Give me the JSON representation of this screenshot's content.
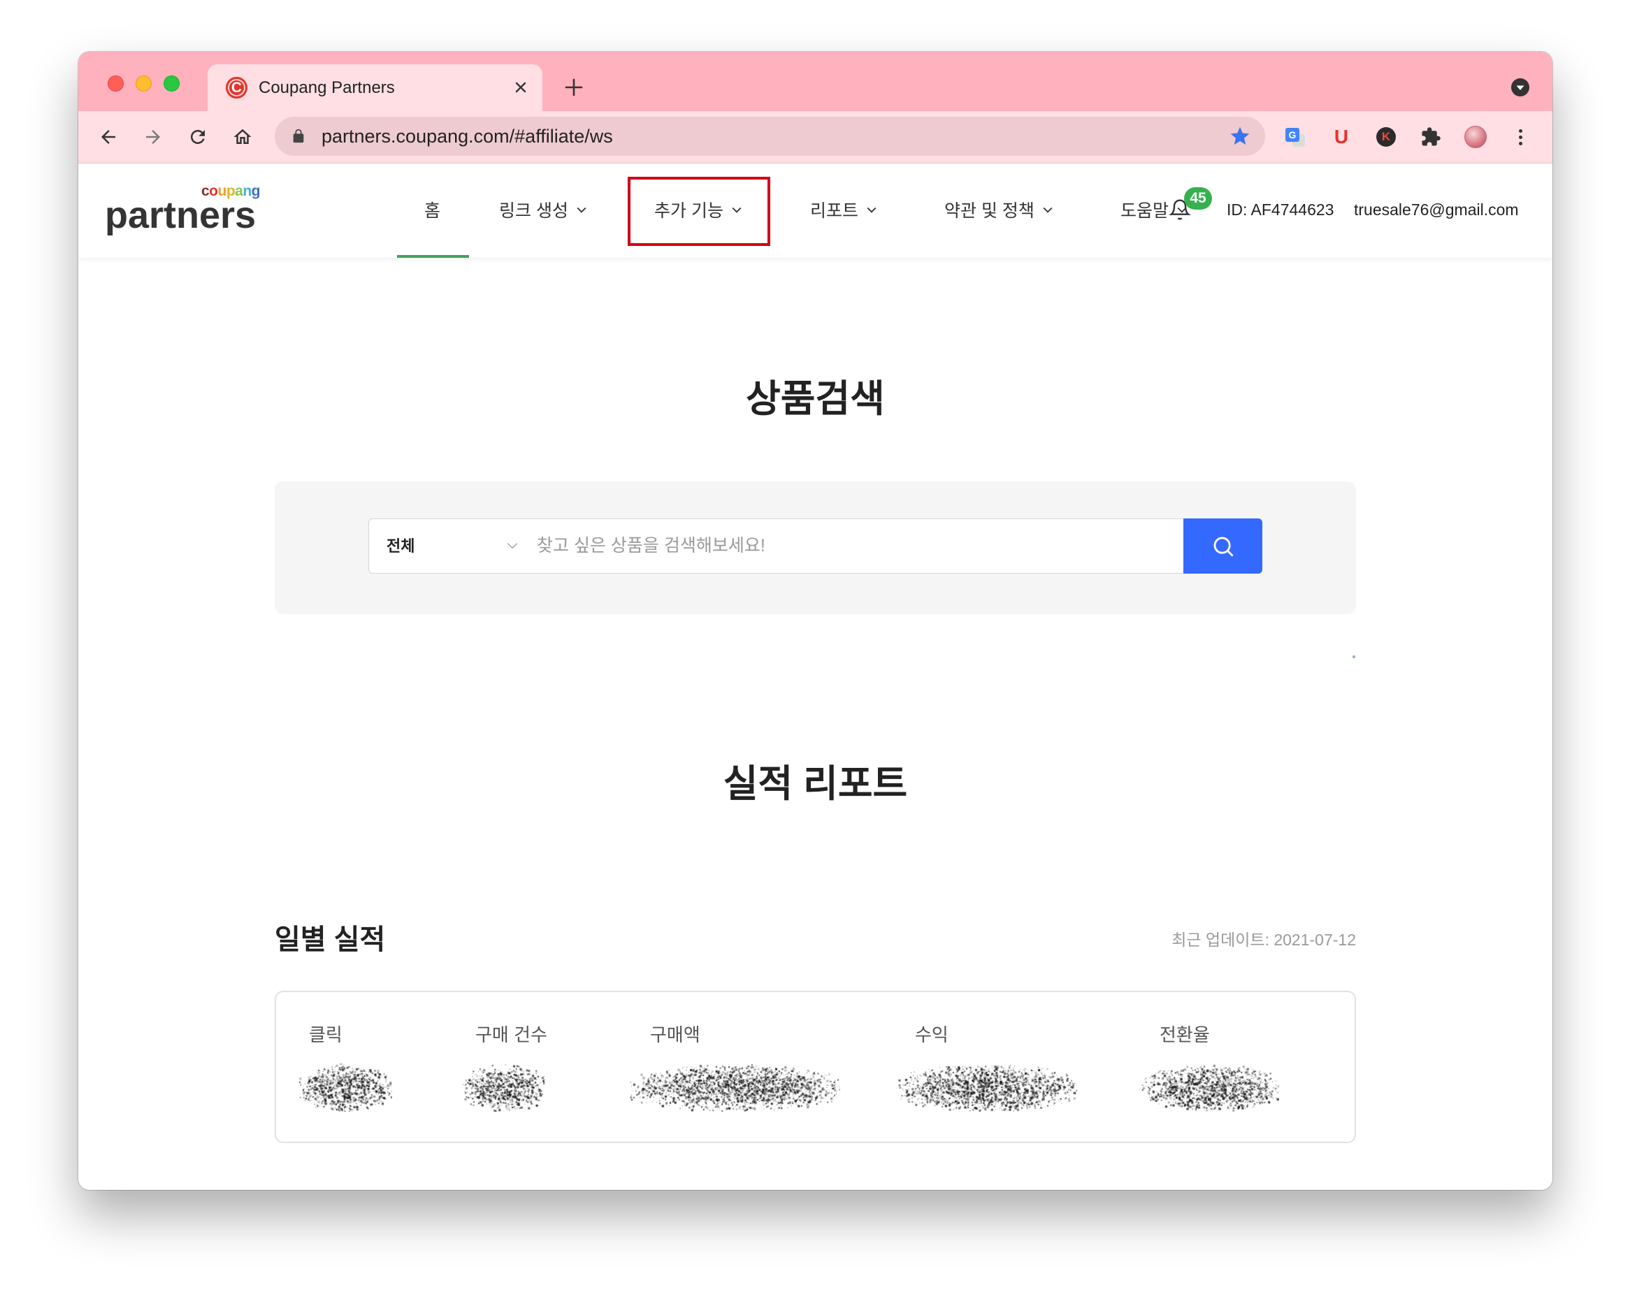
{
  "browser": {
    "tab": {
      "favicon_letter": "C",
      "title": "Coupang Partners"
    },
    "address_bar": {
      "url": "partners.coupang.com/#affiliate/ws"
    },
    "extensions": {
      "translate_letter": "G",
      "u_letter": "U",
      "k_letter": "K"
    },
    "icons": [
      "close-tab-icon",
      "new-tab-plus-icon",
      "tab-search-icon",
      "back-arrow-icon",
      "forward-arrow-icon",
      "reload-icon",
      "home-icon",
      "lock-icon",
      "bookmark-star-icon",
      "google-translate-icon",
      "extensions-puzzle-icon",
      "profile-avatar",
      "chrome-menu-icon"
    ],
    "colors": {
      "tab_strip": "#ffb1bd",
      "toolbar": "#ffdfe4",
      "omnibox": "#eecbd0"
    }
  },
  "header": {
    "logo": {
      "top": "coupang",
      "bottom": "partners",
      "top_letter_colors": [
        "#8a2b2b",
        "#e3342f",
        "#f29b2b",
        "#dcb52a",
        "#8bc34a",
        "#3fb0e0",
        "#3a6fc4"
      ]
    },
    "nav": [
      {
        "label": "홈",
        "active": true,
        "dropdown": false
      },
      {
        "label": "링크 생성",
        "dropdown": true
      },
      {
        "label": "추가 기능",
        "dropdown": true,
        "highlighted": true
      },
      {
        "label": "리포트",
        "dropdown": true
      },
      {
        "label": "약관 및 정책",
        "dropdown": true
      },
      {
        "label": "도움말",
        "dropdown": true
      }
    ],
    "notification_badge": "45",
    "account_id": "ID: AF4744623",
    "email": "truesale76@gmail.com",
    "colors": {
      "active_underline": "#3ea45a",
      "badge": "#35b14f",
      "highlight_box": "#d4001a"
    }
  },
  "product_search": {
    "title": "상품검색",
    "category_select": "전체",
    "placeholder": "찾고 싶은 상품을 검색해보세요!",
    "button_color": "#3469ff"
  },
  "performance_report": {
    "title": "실적 리포트",
    "daily": {
      "title": "일별 실적",
      "last_updated": "최근 업데이트: 2021-07-12",
      "metrics": [
        {
          "label": "클릭"
        },
        {
          "label": "구매 건수"
        },
        {
          "label": "구매액"
        },
        {
          "label": "수익"
        },
        {
          "label": "전환율"
        }
      ]
    }
  }
}
